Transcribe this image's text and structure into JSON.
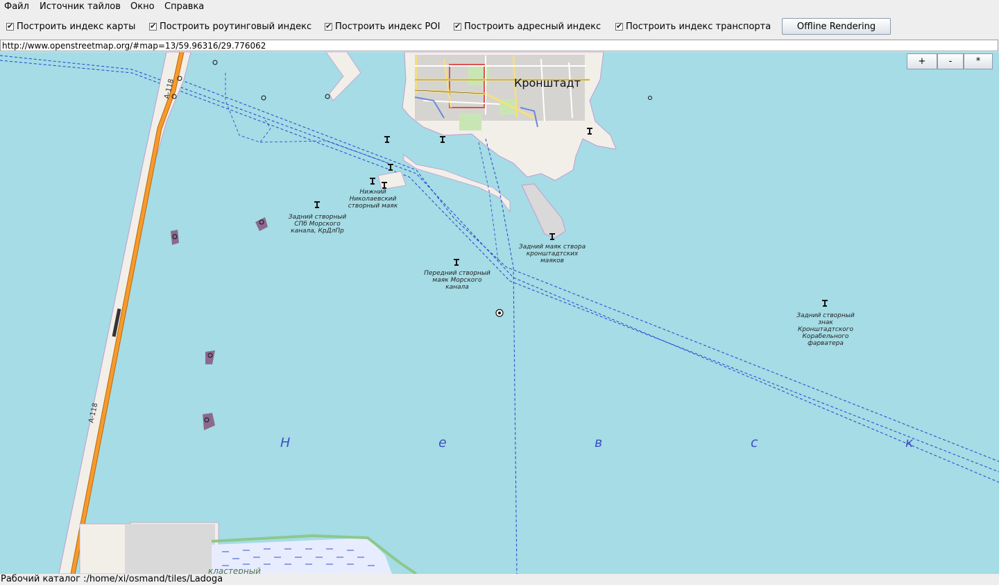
{
  "menu": {
    "items": [
      "Файл",
      "Источник тайлов",
      "Окно",
      "Справка"
    ]
  },
  "toolbar": {
    "checkboxes": [
      {
        "label": "Построить индекс карты",
        "checked": true
      },
      {
        "label": "Построить роутинговый индекс",
        "checked": true
      },
      {
        "label": "Построить индекс POI",
        "checked": true
      },
      {
        "label": "Построить адресный индекс",
        "checked": true
      },
      {
        "label": "Построить индекс транспорта",
        "checked": true
      }
    ],
    "offline_button": "Offline Rendering"
  },
  "url": "http://www.openstreetmap.org/#map=13/59.96316/29.776062",
  "zoom_controls": {
    "zoom_in": "+",
    "zoom_out": "-",
    "center": "*"
  },
  "map": {
    "city": "Кронштадт",
    "road_label": "A-118",
    "sea_letters": [
      "Н",
      "е",
      "в",
      "с",
      "к"
    ],
    "labels": {
      "nikolaevsky": "Нижний\nНиколаевский\nстворный маяк",
      "spb_canal": "Задний створный\nСПб Морского\nканала, КрДлПр",
      "kronstadt_lights": "Задний маяк створа\nкронштадтских\nмаяков",
      "front_light": "Передний створный\nмаяк Морского\nканала",
      "fairway_sign": "Задний створный\nзнак\nКронштадтского\nКорабельного\nфарватера",
      "bottom_partial": "кластерный"
    },
    "colors": {
      "water": "#a5dce5",
      "road": "#f79a2c",
      "land": "#f2efe9",
      "island": "#8c6a8f"
    }
  },
  "status": "Рабочий каталог :/home/xi/osmand/tiles/Ladoga"
}
